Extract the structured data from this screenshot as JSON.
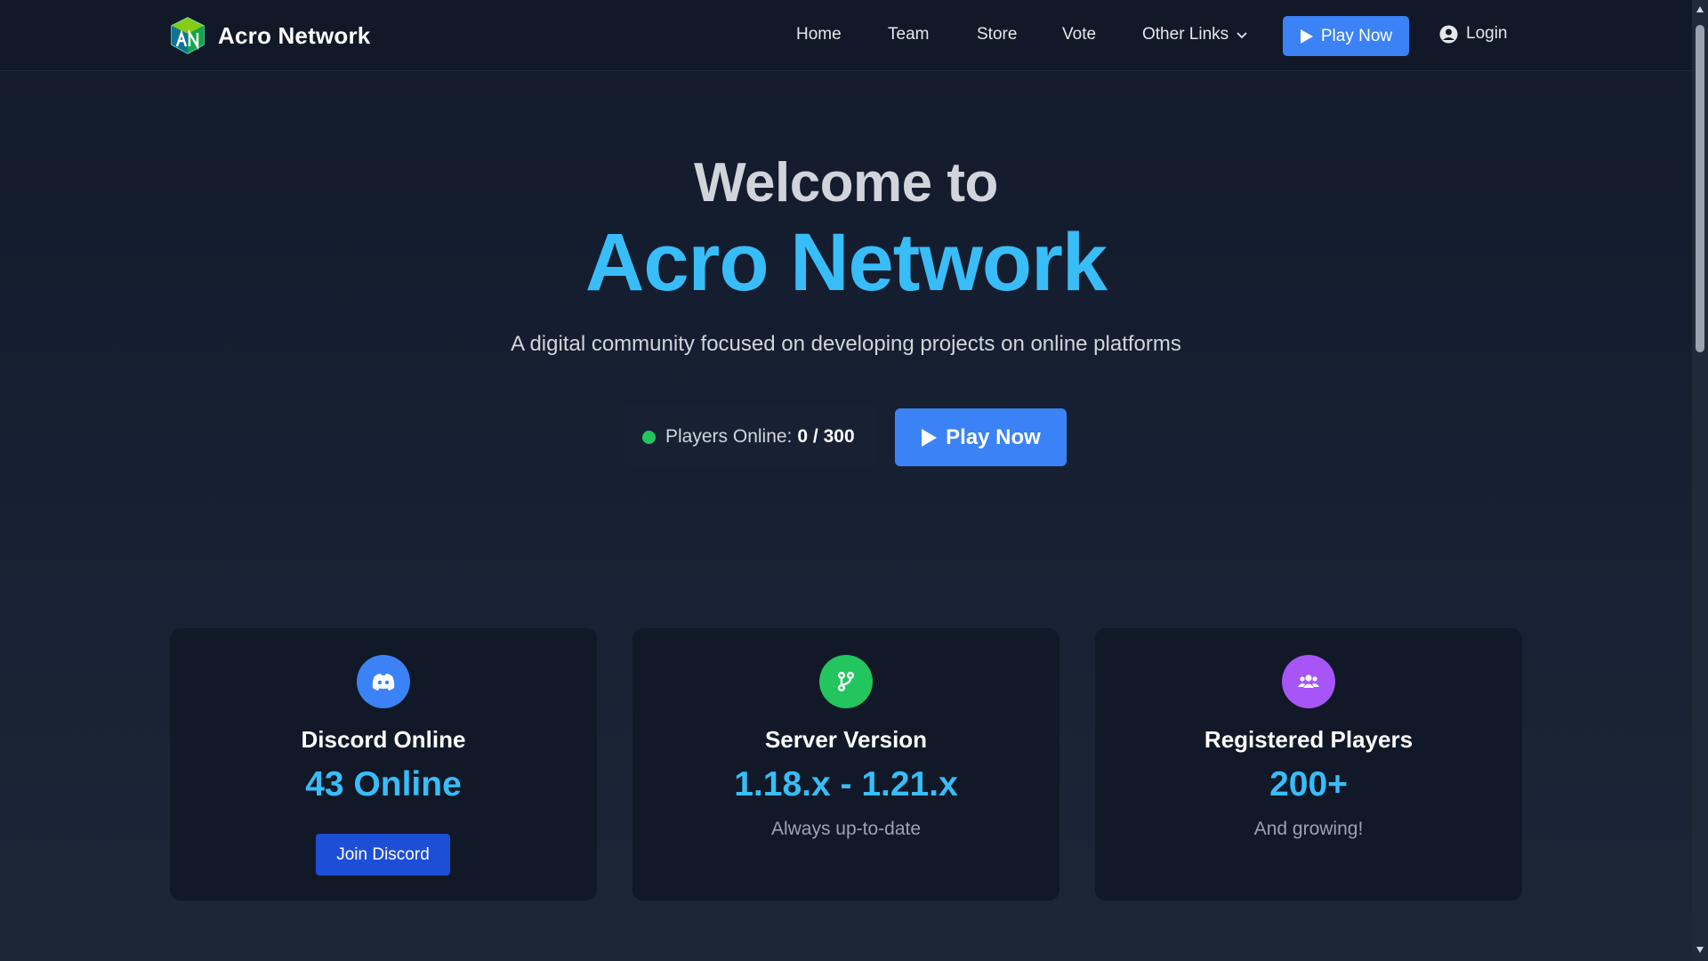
{
  "nav": {
    "brand": "Acro Network",
    "links": [
      {
        "label": "Home"
      },
      {
        "label": "Team"
      },
      {
        "label": "Store"
      },
      {
        "label": "Vote"
      },
      {
        "label": "Other Links"
      }
    ],
    "play_label": "Play Now",
    "login_label": "Login"
  },
  "hero": {
    "welcome": "Welcome to",
    "title": "Acro Network",
    "subtitle": "A digital community focused on developing projects on online platforms",
    "players_label": "Players Online:",
    "players_count": "0 / 300",
    "play_label": "Play Now"
  },
  "cards": [
    {
      "icon": "discord-icon",
      "title": "Discord Online",
      "value": "43 Online",
      "button": "Join Discord",
      "color": "#3b82f6"
    },
    {
      "icon": "branch-icon",
      "title": "Server Version",
      "value": "1.18.x - 1.21.x",
      "note": "Always up-to-date",
      "color": "#22c55e"
    },
    {
      "icon": "users-icon",
      "title": "Registered Players",
      "value": "200+",
      "note": "And growing!",
      "color": "#a855f7"
    }
  ],
  "colors": {
    "accent": "#3b82f6",
    "highlight": "#38bdf8",
    "online": "#22c55e",
    "background": "#151d2e",
    "card": "#111827"
  }
}
